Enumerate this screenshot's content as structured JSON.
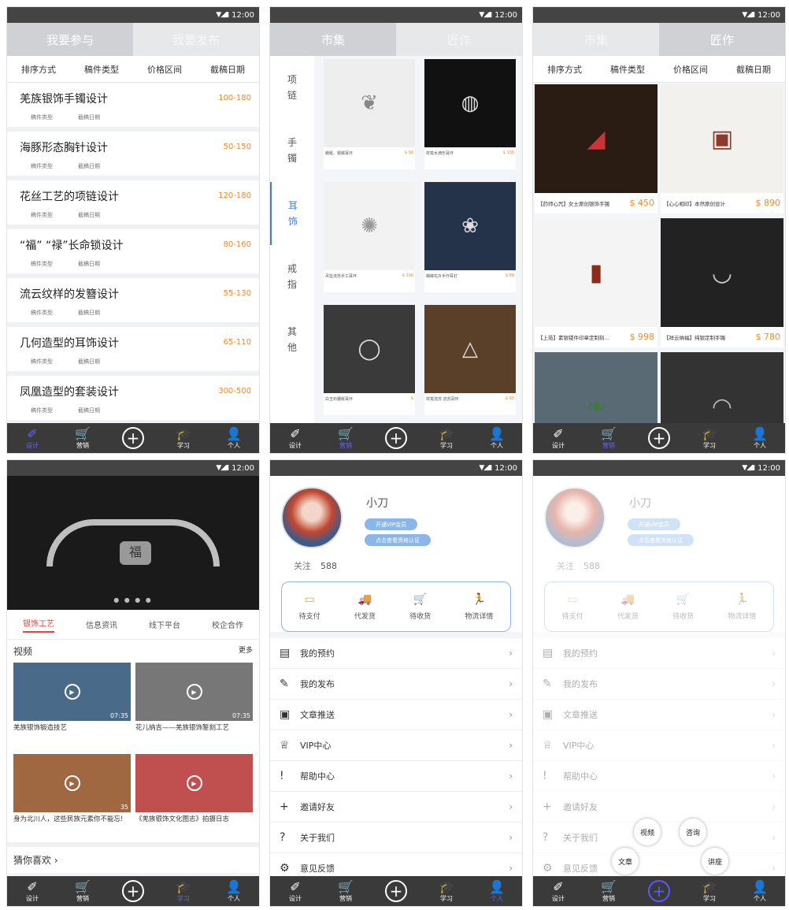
{
  "status": {
    "time": "12:00",
    "signal": "▼◢▮"
  },
  "tabbar": [
    {
      "icon": "✐",
      "label": "设计"
    },
    {
      "icon": "🛒",
      "label": "营销"
    },
    {
      "icon": "+",
      "label": ""
    },
    {
      "icon": "🎓",
      "label": "学习"
    },
    {
      "icon": "👤",
      "label": "个人"
    }
  ],
  "screen1": {
    "tabs": [
      "我要参与",
      "我要发布"
    ],
    "filters": [
      "排序方式",
      "稿件类型",
      "价格区间",
      "截稿日期"
    ],
    "meta_labels": [
      "稿件类型",
      "截稿日期"
    ],
    "jobs": [
      {
        "title": "羌族银饰手镯设计",
        "price": "100-180"
      },
      {
        "title": "海豚形态胸针设计",
        "price": "50-150"
      },
      {
        "title": "花丝工艺的项链设计",
        "price": "120-180"
      },
      {
        "title": "“福” “禄”长命锁设计",
        "price": "80-160"
      },
      {
        "title": "流云纹样的发簪设计",
        "price": "55-130"
      },
      {
        "title": "几何造型的耳饰设计",
        "price": "65-110"
      },
      {
        "title": "凤凰造型的套装设计",
        "price": "300-500"
      }
    ]
  },
  "screen2": {
    "tabs": [
      "市集",
      "匠作"
    ],
    "categories": [
      {
        "line1": "项",
        "line2": "链"
      },
      {
        "line1": "手",
        "line2": "镯"
      },
      {
        "line1": "耳",
        "line2": "饰"
      },
      {
        "line1": "戒",
        "line2": "指"
      },
      {
        "line1": "其",
        "line2": "他"
      }
    ],
    "goods": [
      {
        "name": "蜻蜓、银蝶耳环",
        "price": "$ 98"
      },
      {
        "name": "祥鸾水滴形耳环",
        "price": "$ 130"
      },
      {
        "name": "吊坠流苏手工耳环",
        "price": "$ 100"
      },
      {
        "name": "蝴蝶花卉手作耳钉",
        "price": "$ 89"
      },
      {
        "name": "白玉石镶嵌耳环",
        "price": "$"
      },
      {
        "name": "祥鸾流苏 流苏耳环",
        "price": "$ 80"
      }
    ]
  },
  "screen3": {
    "tabs": [
      "市集",
      "匠作"
    ],
    "filters": [
      "排序方式",
      "稿件类型",
      "价格区间",
      "截稿日期"
    ],
    "works": [
      {
        "name": "【药师心咒】女士原创银饰手镯",
        "price": "$ 450"
      },
      {
        "name": "【心心相印】本然原创设计",
        "price": "$ 890"
      },
      {
        "name": "【上苑】素银镂件印章定制刻...",
        "price": "$ 998"
      },
      {
        "name": "【祥云纳福】纯银定制手镯",
        "price": "$ 780"
      },
      {
        "name": "",
        "price": ""
      },
      {
        "name": "",
        "price": ""
      }
    ]
  },
  "screen4": {
    "hero_char": "福",
    "subtabs": [
      "银饰工艺",
      "信息资讯",
      "线下平台",
      "校企合作"
    ],
    "video_section": "视频",
    "more": "更多",
    "videos": [
      {
        "title": "羌族银饰锻造技艺",
        "dur": "07:35"
      },
      {
        "title": "花儿纳吉——羌族银饰錾刻工艺",
        "dur": "07:35"
      },
      {
        "title": "身为北川人，这些民族元素你不能忘!",
        "dur": "35"
      },
      {
        "title": "《羌族银饰文化图志》拍摄日志",
        "dur": ""
      }
    ],
    "guess": "猜你喜欢 ›"
  },
  "screen5": {
    "name": "小刀",
    "vip": "开通VIP会员",
    "verify": "点击查看资格认证",
    "follow_label": "关注",
    "follow_count": "588",
    "orders": [
      {
        "icon": "▭",
        "label": "待支付"
      },
      {
        "icon": "🚚",
        "label": "代发货"
      },
      {
        "icon": "🛒",
        "label": "待收货"
      },
      {
        "icon": "🏃",
        "label": "物流详情"
      }
    ],
    "menu": [
      {
        "icon": "▤",
        "label": "我的预约"
      },
      {
        "icon": "✎",
        "label": "我的发布"
      },
      {
        "icon": "▣",
        "label": "文章推送"
      },
      {
        "icon": "♕",
        "label": "VIP中心"
      },
      {
        "icon": "!",
        "label": "帮助中心"
      },
      {
        "icon": "+",
        "label": "邀请好友"
      },
      {
        "icon": "?",
        "label": "关于我们"
      },
      {
        "icon": "⚙",
        "label": "意见反馈"
      }
    ]
  },
  "screen6": {
    "fabs": {
      "video": "视频",
      "consult": "咨询",
      "article": "文章",
      "lecture": "讲座"
    }
  },
  "colors": {
    "accent": "#5b58ff",
    "price": "#f08a2a",
    "sub_active": "#e8443a",
    "blue": "#8ab6e8"
  }
}
